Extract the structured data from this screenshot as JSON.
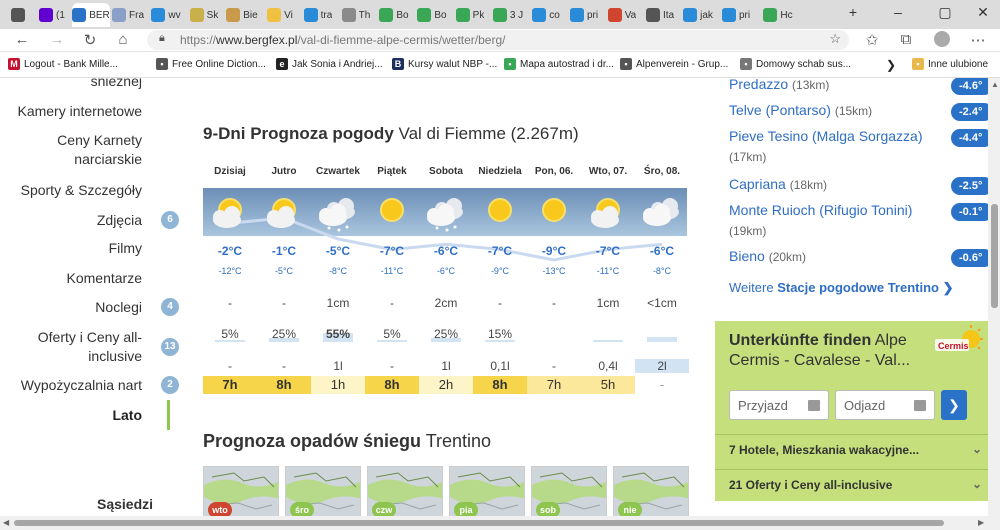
{
  "browser": {
    "tabs": [
      {
        "label": "",
        "icon": "window-icon",
        "color": "#555555"
      },
      {
        "label": "(1",
        "icon": "yahoo-mail-icon",
        "color": "#6001d2"
      },
      {
        "label": "BER",
        "icon": "bergfex-icon",
        "color": "#2a72c8",
        "active": true
      },
      {
        "label": "Fra",
        "icon": "page-icon",
        "color": "#8aa0c8"
      },
      {
        "label": "wv",
        "icon": "bing-icon",
        "color": "#2a8bd8"
      },
      {
        "label": "Sk",
        "icon": "page-icon",
        "color": "#c8b04a"
      },
      {
        "label": "Bie",
        "icon": "page-icon",
        "color": "#c89a4a"
      },
      {
        "label": "Vi",
        "icon": "sun-icon",
        "color": "#f0c040"
      },
      {
        "label": "tra",
        "icon": "bing-icon",
        "color": "#2a8bd8"
      },
      {
        "label": "Th",
        "icon": "page-icon",
        "color": "#8a8a8a"
      },
      {
        "label": "Bo",
        "icon": "maps-icon",
        "color": "#3aa757"
      },
      {
        "label": "Bo",
        "icon": "maps-icon",
        "color": "#3aa757"
      },
      {
        "label": "Pk",
        "icon": "maps-icon",
        "color": "#3aa757"
      },
      {
        "label": "3 J",
        "icon": "maps-icon",
        "color": "#3aa757"
      },
      {
        "label": "co",
        "icon": "bing-icon",
        "color": "#2a8bd8"
      },
      {
        "label": "pri",
        "icon": "bing-icon",
        "color": "#2a8bd8"
      },
      {
        "label": "Va",
        "icon": "blocked-icon",
        "color": "#d0452f"
      },
      {
        "label": "Ita",
        "icon": "page-icon",
        "color": "#555555"
      },
      {
        "label": "jak",
        "icon": "bing-icon",
        "color": "#2a8bd8"
      },
      {
        "label": "pri",
        "icon": "bing-icon",
        "color": "#2a8bd8"
      },
      {
        "label": "Hc",
        "icon": "globe-icon",
        "color": "#3aa757"
      }
    ],
    "url_prefix": "https://",
    "url_domain": "www.bergfex.pl",
    "url_path": "/val-di-fiemme-alpe-cermis/wetter/berg/",
    "favorites": [
      {
        "label": "Logout - Bank Mille...",
        "icon": "M",
        "color": "#c8102e"
      },
      {
        "label": "Free Online Diction...",
        "icon": "•",
        "color": "#555555"
      },
      {
        "label": "Jak Sonia i Andriej...",
        "icon": "e",
        "color": "#222222"
      },
      {
        "label": "Kursy walut NBP -...",
        "icon": "B",
        "color": "#1c2f5e"
      },
      {
        "label": "Mapa autostrad i dr...",
        "icon": "•",
        "color": "#3aa757"
      },
      {
        "label": "Alpenverein - Grup...",
        "icon": "▪",
        "color": "#555555"
      },
      {
        "label": "Domowy schab sus...",
        "icon": "•",
        "color": "#777777"
      },
      {
        "label": "Inne ulubione",
        "icon": "▪",
        "color": "#e8b84a"
      }
    ]
  },
  "menu": {
    "items": [
      {
        "label": "śnieżnej"
      },
      {
        "label": "Kamery internetowe"
      },
      {
        "label": "Ceny Karnety narciarskie"
      },
      {
        "label": "Sporty & Szczegóły"
      },
      {
        "label": "Zdjęcia",
        "badge": "6"
      },
      {
        "label": "Filmy"
      },
      {
        "label": "Komentarze"
      },
      {
        "label": "Noclegi",
        "badge": "4"
      },
      {
        "label": "Oferty i Ceny all-inclusive",
        "badge": "13"
      },
      {
        "label": "Wypożyczalnia nart",
        "badge": "2"
      },
      {
        "label": "Lato",
        "active": true
      }
    ],
    "neighbors": "Sąsiedzi"
  },
  "forecast": {
    "title_bold": "9-Dni Prognoza pogody",
    "title_rest": "Val di Fiemme (2.267m)",
    "days": [
      {
        "name": "Dzisiaj",
        "icon": "sun-cloud-icon",
        "max": "-2°C",
        "min": "-12°C",
        "snow": "-",
        "prob": "5%",
        "prob_value": 0.05,
        "precip": "-",
        "sun": "7h",
        "sun_level": "high"
      },
      {
        "name": "Jutro",
        "icon": "sun-cloud-icon",
        "max": "-1°C",
        "min": "-5°C",
        "snow": "-",
        "prob": "25%",
        "prob_value": 0.25,
        "precip": "-",
        "sun": "8h",
        "sun_level": "high"
      },
      {
        "name": "Czwartek",
        "icon": "cloud-snow-icon",
        "max": "-5°C",
        "min": "-8°C",
        "snow": "1cm",
        "prob": "55%",
        "prob_value": 0.55,
        "precip": "1l",
        "sun": "1h",
        "sun_level": "low"
      },
      {
        "name": "Piątek",
        "icon": "sun-icon",
        "max": "-7°C",
        "min": "-11°C",
        "snow": "-",
        "prob": "5%",
        "prob_value": 0.05,
        "precip": "-",
        "sun": "8h",
        "sun_level": "high"
      },
      {
        "name": "Sobota",
        "icon": "cloud-snow-icon",
        "max": "-6°C",
        "min": "-6°C",
        "snow": "2cm",
        "prob": "25%",
        "prob_value": 0.25,
        "precip": "1l",
        "sun": "2h",
        "sun_level": "low"
      },
      {
        "name": "Niedziela",
        "icon": "sun-icon",
        "max": "-7°C",
        "min": "-9°C",
        "snow": "-",
        "prob": "15%",
        "prob_value": 0.15,
        "precip": "0,1l",
        "sun": "8h",
        "sun_level": "high"
      },
      {
        "name": "Pon, 06.",
        "icon": "sun-icon",
        "max": "-9°C",
        "min": "-13°C",
        "snow": "-",
        "prob": "",
        "prob_value": 0.0,
        "precip": "-",
        "sun": "7h",
        "sun_level": "mid"
      },
      {
        "name": "Wto, 07.",
        "icon": "sun-cloud-icon",
        "max": "-7°C",
        "min": "-11°C",
        "snow": "1cm",
        "prob": "",
        "prob_value": 0.08,
        "precip": "0,4l",
        "sun": "5h",
        "sun_level": "mid"
      },
      {
        "name": "Śro, 08.",
        "icon": "cloud-icon",
        "max": "-6°C",
        "min": "-8°C",
        "snow": "<1cm",
        "prob": "",
        "prob_value": 0.3,
        "precip": "2l",
        "sun": "-",
        "sun_level": "none"
      }
    ]
  },
  "snow_maps": {
    "title_bold": "Prognoza opadów śniegu",
    "title_rest": "Trentino",
    "items": [
      {
        "label": "wto",
        "color": "#d0452f"
      },
      {
        "label": "śro",
        "color": "#8ec54f"
      },
      {
        "label": "czw",
        "color": "#8ec54f"
      },
      {
        "label": "pia",
        "color": "#8ec54f"
      },
      {
        "label": "sob",
        "color": "#8ec54f"
      },
      {
        "label": "nie",
        "color": "#8ec54f"
      }
    ]
  },
  "stations": {
    "items": [
      {
        "name": "Predazzo",
        "dist": "(13km)",
        "temp": "-4.6°"
      },
      {
        "name": "Telve (Pontarso)",
        "dist": "(15km)",
        "temp": "-2.4°"
      },
      {
        "name": "Pieve Tesino (Malga Sorgazza)",
        "dist": "(17km)",
        "temp": "-4.4°"
      },
      {
        "name": "Capriana",
        "dist": "(18km)",
        "temp": "-2.5°"
      },
      {
        "name": "Monte Ruioch (Rifugio Tonini)",
        "dist": "(19km)",
        "temp": "-0.1°"
      },
      {
        "name": "Bieno",
        "dist": "(20km)",
        "temp": "-0.6°"
      }
    ],
    "more_prefix": "Weitere",
    "more_bold": "Stacje pogodowe Trentino",
    "more_arrow": "❯"
  },
  "accommodation": {
    "title_bold": "Unterkünfte finden",
    "title_rest": "Alpe Cermis - Cavalese - Val...",
    "arrive_placeholder": "Przyjazd",
    "depart_placeholder": "Odjazd",
    "go_label": "❯",
    "rows": [
      {
        "label": "7 Hotele, Mieszkania wakacyjne..."
      },
      {
        "label": "21 Oferty i Ceny all-inclusive"
      }
    ],
    "logo_text": "Cermis"
  },
  "colors": {
    "accent_blue": "#2a72c8",
    "temp_blue": "#2f6ec4",
    "green_box": "#c4df7c",
    "sun_high": "#f6d54a",
    "sun_mid": "#fbe89a",
    "sun_low": "#fdf4c8"
  }
}
